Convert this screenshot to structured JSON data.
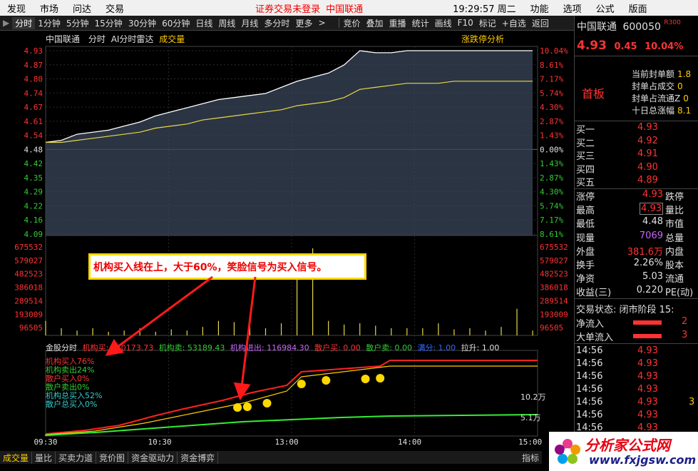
{
  "menubar": {
    "items": [
      "发现",
      "市场",
      "问达",
      "交易",
      "功能",
      "选项",
      "公式",
      "版面"
    ],
    "status": "证券交易未登录",
    "stock_name": "中国联通",
    "clock": "19:29:57 周二"
  },
  "toolbar": {
    "periods": [
      "分时",
      "1分钟",
      "5分钟",
      "15分钟",
      "30分钟",
      "60分钟",
      "日线",
      "周线",
      "月线",
      "多分时",
      "更多"
    ],
    "actions": [
      "竞价",
      "叠加",
      "重播",
      "统计",
      "画线",
      "F10",
      "标记",
      "+自选",
      "返回"
    ]
  },
  "chart_header": {
    "name": "中国联通",
    "mode": "分时",
    "radar": "AI分时雷达",
    "volume_label": "成交量",
    "limit_analysis": "涨跌停分析"
  },
  "chart_data": {
    "type": "line",
    "price_ticks": [
      "4.93",
      "4.87",
      "4.80",
      "4.74",
      "4.67",
      "4.61",
      "4.54",
      "4.48",
      "4.42",
      "4.35",
      "4.29",
      "4.22",
      "4.16",
      "4.09"
    ],
    "pct_ticks": [
      "10.04%",
      "8.61%",
      "7.17%",
      "5.74%",
      "4.30%",
      "2.87%",
      "1.43%",
      "0.00%",
      "1.43%",
      "2.87%",
      "4.30%",
      "5.74%",
      "7.17%",
      "8.61%"
    ],
    "volume_ticks": [
      "675532",
      "579027",
      "482523",
      "386018",
      "289514",
      "193009",
      "96505"
    ],
    "ylim": [
      4.03,
      4.93
    ],
    "time_ticks": [
      "09:30",
      "10:30",
      "13:00",
      "14:00",
      "15:00"
    ],
    "series": [
      {
        "name": "price",
        "values": [
          4.48,
          4.49,
          4.52,
          4.53,
          4.54,
          4.56,
          4.58,
          4.61,
          4.63,
          4.65,
          4.67,
          4.69,
          4.7,
          4.71,
          4.72,
          4.75,
          4.78,
          4.8,
          4.82,
          4.86,
          4.93,
          4.92,
          4.92,
          4.93,
          4.93,
          4.93,
          4.93,
          4.93,
          4.93,
          4.93,
          4.93,
          4.93
        ]
      },
      {
        "name": "avg",
        "values": [
          4.48,
          4.48,
          4.49,
          4.5,
          4.51,
          4.52,
          4.53,
          4.55,
          4.56,
          4.57,
          4.59,
          4.6,
          4.61,
          4.62,
          4.63,
          4.64,
          4.66,
          4.67,
          4.68,
          4.7,
          4.74,
          4.75,
          4.76,
          4.77,
          4.77,
          4.77,
          4.78,
          4.78,
          4.78,
          4.78,
          4.78,
          4.78
        ]
      }
    ],
    "volume": [
      120000,
      60000,
      40000,
      60000,
      30000,
      40000,
      60000,
      30000,
      50000,
      40000,
      70000,
      120000,
      110000,
      130000,
      60000,
      100000,
      520000,
      720000,
      120000,
      90000,
      100000,
      80000,
      60000,
      60000,
      60000,
      100000,
      50000,
      60000,
      40000,
      70000,
      220000,
      40000
    ]
  },
  "indicator": {
    "title": "金股分时",
    "jg_buy": "机构买: 110173.73",
    "jg_sell": "机构卖: 53189.43",
    "jg_net": "机构进出: 116984.30",
    "sh_buy": "散户买: 0.00",
    "sh_sell": "散户卖: 0.00",
    "extra": "满分: 1.00",
    "pull": "拉升: 1.00",
    "legend": [
      "机构买入76%",
      "机构卖出24%",
      "散户买入0%",
      "散户卖出0%",
      "机构总买入52%",
      "散户总买入0%"
    ],
    "scale_high": "10.2万",
    "scale_low": "5.1万"
  },
  "annotation": "机构买入线在上，大于60%，笑脸信号为买入信号。",
  "bottom_tabs": [
    "成交量",
    "量比",
    "买卖力道",
    "竞价图",
    "资金驱动力",
    "资金博弈"
  ],
  "bottom_right": "指标",
  "quote": {
    "name": "中国联通",
    "code": "600050",
    "tag": "R300",
    "price": "4.93",
    "change": "0.45",
    "pct": "10.04%",
    "board": "首板",
    "seal_labels": [
      "当前封单额",
      "封单占成交",
      "封单占流通Z",
      "十日总涨幅"
    ],
    "seal_values": [
      "1.8",
      "0",
      "0",
      "8.1"
    ],
    "bids": [
      {
        "label": "买一",
        "price": "4.93"
      },
      {
        "label": "买二",
        "price": "4.92"
      },
      {
        "label": "买三",
        "price": "4.91"
      },
      {
        "label": "买四",
        "price": "4.90"
      },
      {
        "label": "买五",
        "price": "4.89"
      }
    ],
    "stats": [
      {
        "label": "涨停",
        "value": "4.93",
        "label2": "跌停"
      },
      {
        "label": "最高",
        "value": "4.93",
        "label2": "量比"
      },
      {
        "label": "最低",
        "value": "4.48",
        "label2": "市值"
      },
      {
        "label": "现量",
        "value": "7069",
        "label2": "总量"
      },
      {
        "label": "外盘",
        "value": "381.6万",
        "label2": "内盘"
      },
      {
        "label": "换手",
        "value": "2.26%",
        "label2": "股本"
      },
      {
        "label": "净资",
        "value": "5.03",
        "label2": "流通"
      },
      {
        "label": "收益(三)",
        "value": "0.220",
        "label2": "PE(动)"
      }
    ],
    "trade_state": "交易状态: 闭市阶段 15:",
    "net_flow": "净流入",
    "big_flow": "大单流入",
    "net_flow_val": "2",
    "big_flow_val": "3",
    "ticks": [
      {
        "time": "14:56",
        "price": "4.93",
        "vol": ""
      },
      {
        "time": "14:56",
        "price": "4.93",
        "vol": ""
      },
      {
        "time": "14:56",
        "price": "4.93",
        "vol": ""
      },
      {
        "time": "14:56",
        "price": "4.93",
        "vol": ""
      },
      {
        "time": "14:56",
        "price": "4.93",
        "vol": "3"
      },
      {
        "time": "14:56",
        "price": "4.93",
        "vol": ""
      },
      {
        "time": "14:56",
        "price": "4.93",
        "vol": ""
      }
    ]
  },
  "watermark": {
    "title": "分析家公式网",
    "url": "www.fxjgsw.com"
  }
}
